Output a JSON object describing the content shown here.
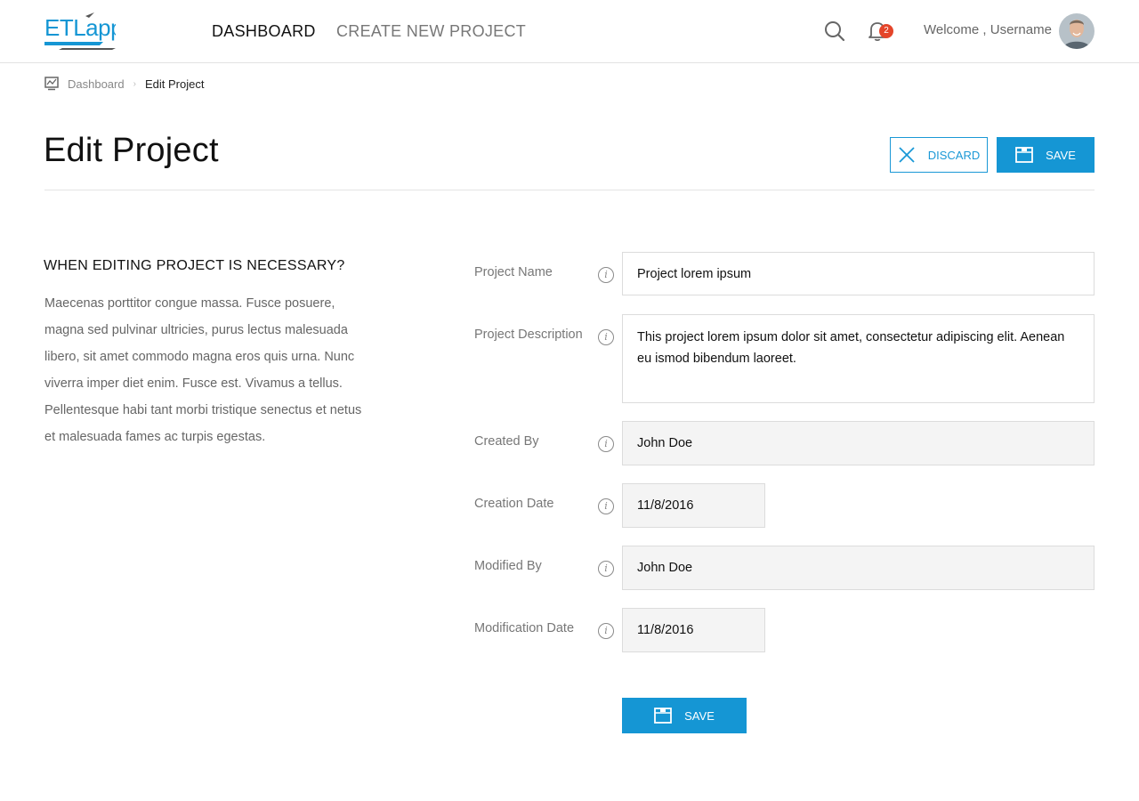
{
  "header": {
    "logo_text": "ETLapp",
    "nav": [
      {
        "label": "DASHBOARD"
      },
      {
        "label": "CREATE NEW PROJECT"
      }
    ],
    "notification_count": "2",
    "welcome": "Welcome , Username",
    "icons": {
      "search": "search-icon",
      "bell": "bell-icon",
      "avatar": "user-avatar"
    }
  },
  "breadcrumb": {
    "items": [
      {
        "label": "Dashboard"
      },
      {
        "label": "Edit Project"
      }
    ]
  },
  "page": {
    "title": "Edit Project",
    "discard_label": "DISCARD",
    "save_label": "SAVE"
  },
  "info": {
    "heading": "WHEN EDITING PROJECT IS NECESSARY?",
    "body": "Maecenas porttitor congue massa. Fusce posuere, magna sed pulvinar ultricies, purus lectus malesuada libero, sit amet commodo magna eros quis urna. Nunc viverra imper diet enim. Fusce est. Vivamus a tellus. Pellentesque habi tant morbi tristique senectus et netus et malesuada fames ac turpis egestas."
  },
  "form": {
    "fields": [
      {
        "label": "Project Name",
        "value": "Project lorem ipsum"
      },
      {
        "label": "Project Description",
        "value": "This project lorem ipsum dolor sit amet, consectetur adipiscing elit. Aenean eu ismod bibendum laoreet."
      },
      {
        "label": "Created By",
        "value": "John Doe"
      },
      {
        "label": "Creation Date",
        "value": "11/8/2016"
      },
      {
        "label": "Modified By",
        "value": "John Doe"
      },
      {
        "label": "Modification Date",
        "value": "11/8/2016"
      }
    ],
    "save_label": "SAVE"
  },
  "colors": {
    "accent": "#1596d4",
    "badge": "#e4452a",
    "readonly_bg": "#f4f4f4"
  }
}
